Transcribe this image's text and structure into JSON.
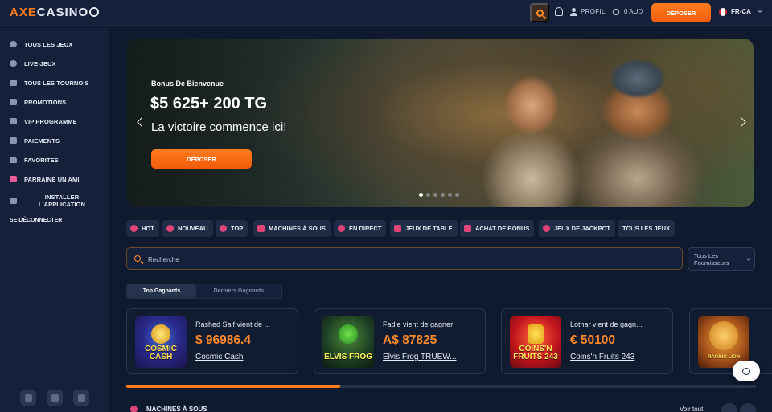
{
  "header": {
    "logo_axe": "AXE",
    "logo_casino": "CASINO",
    "profile_label": "PROFIL",
    "balance": "0 AUD",
    "deposit_label": "DÉPOSER",
    "language": "FR-CA"
  },
  "sidebar": {
    "items": [
      {
        "label": "TOUS LES JEUX",
        "icon": "star-icon"
      },
      {
        "label": "LIVE-JEUX",
        "icon": "live-icon"
      },
      {
        "label": "TOUS LES TOURNOIS",
        "icon": "trophy-icon"
      },
      {
        "label": "PROMOTIONS",
        "icon": "megaphone-icon"
      },
      {
        "label": "VIP PROGRAMME",
        "icon": "crown-icon"
      },
      {
        "label": "PAIEMENTS",
        "icon": "card-icon"
      },
      {
        "label": "FAVORITES",
        "icon": "heart-icon"
      },
      {
        "label": "PARRAINE UN AMI",
        "icon": "referral-icon"
      },
      {
        "label": "INSTALLER L'APPLICATION",
        "icon": "grid-icon"
      }
    ],
    "logout_label": "SE DÉCONNECTER",
    "social": [
      "instagram-icon",
      "telegram-icon",
      "facebook-icon"
    ]
  },
  "hero": {
    "subtitle": "Bonus De Bienvenue",
    "title": "$5 625+ 200 TG",
    "tagline": "La victoire commence ici!",
    "button": "DÉPOSER",
    "slides": 6,
    "active_slide": 1
  },
  "categories": [
    {
      "label": "HOT",
      "icon": "fire-icon"
    },
    {
      "label": "NOUVEAU",
      "icon": "new-icon"
    },
    {
      "label": "TOP",
      "icon": "top-icon"
    },
    {
      "label": "MACHINES À SOUS",
      "icon": "slots-icon"
    },
    {
      "label": "EN DIRECT",
      "icon": "live-icon"
    },
    {
      "label": "JEUX DE TABLE",
      "icon": "table-icon"
    },
    {
      "label": "ACHAT DE BONUS",
      "icon": "gift-icon"
    },
    {
      "label": "JEUX DE JACKPOT",
      "icon": "jackpot-icon"
    },
    {
      "label": "TOUS LES JEUX",
      "icon": ""
    }
  ],
  "search": {
    "placeholder": "Recherche",
    "providers_label": "Tous Les Fournisseurs"
  },
  "tabs": {
    "active": "Top Gagnants",
    "inactive": "Derniers Gagnants"
  },
  "winners": [
    {
      "text": "Rashed Saif vient de ...",
      "amount": "$ 96986.4",
      "game": "Cosmic Cash",
      "thumb_label": "COSMIC CASH"
    },
    {
      "text": "Fadie vient de gagner",
      "amount": "A$ 87825",
      "game": "Elvis Frog TRUEW...",
      "thumb_label": "ELVIS FROG"
    },
    {
      "text": "Lothar vient de gagn...",
      "amount": "€ 50100",
      "game": "Coins'n Fruits 243",
      "thumb_label": "COINS'N FRUITS 243"
    },
    {
      "text": "",
      "amount": "",
      "game": "",
      "thumb_label": "RAGING LION"
    }
  ],
  "carousel_progress": 0.34,
  "next_section": {
    "title": "MACHINES À SOUS",
    "see_all": "Voir tout"
  },
  "colors": {
    "accent": "#ff7a1a",
    "background": "#0f1a2e",
    "panel": "#15213a",
    "chip": "#1f2c46",
    "category_icon": "#e0457a"
  }
}
